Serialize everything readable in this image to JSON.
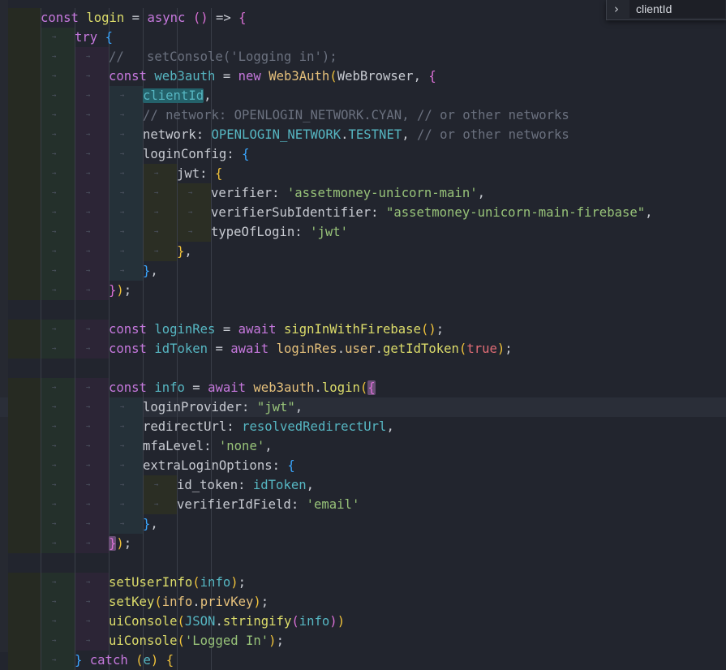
{
  "editor": {
    "current_line": 20,
    "lines": [
      {
        "indent": 0,
        "tokens": [
          [
            "k",
            "const "
          ],
          [
            "fn",
            "login"
          ],
          [
            "op",
            " = "
          ],
          [
            "k",
            "async"
          ],
          [
            "p",
            " "
          ],
          [
            "b2",
            "()"
          ],
          [
            "op",
            " => "
          ],
          [
            "b2",
            "{"
          ]
        ]
      },
      {
        "indent": 1,
        "tokens": [
          [
            "k",
            "try"
          ],
          [
            "p",
            " "
          ],
          [
            "b3",
            "{"
          ]
        ]
      },
      {
        "indent": 2,
        "tokens": [
          [
            "c",
            "//   setConsole('Logging in');"
          ]
        ]
      },
      {
        "indent": 2,
        "tokens": [
          [
            "k",
            "const "
          ],
          [
            "v",
            "web3auth"
          ],
          [
            "op",
            " = "
          ],
          [
            "k",
            "new "
          ],
          [
            "f",
            "Web3Auth"
          ],
          [
            "b1",
            "("
          ],
          [
            "p",
            "WebBrowser, "
          ],
          [
            "b2",
            "{"
          ]
        ]
      },
      {
        "indent": 3,
        "tokens": [
          [
            "v hl",
            "clientId"
          ],
          [
            "p",
            ","
          ]
        ]
      },
      {
        "indent": 3,
        "tokens": [
          [
            "c",
            "// network: OPENLOGIN_NETWORK.CYAN, // or other networks"
          ]
        ]
      },
      {
        "indent": 3,
        "tokens": [
          [
            "p",
            "network: "
          ],
          [
            "v",
            "OPENLOGIN_NETWORK"
          ],
          [
            "p",
            "."
          ],
          [
            "v",
            "TESTNET"
          ],
          [
            "p",
            ", "
          ],
          [
            "c",
            "// or other networks"
          ]
        ]
      },
      {
        "indent": 3,
        "tokens": [
          [
            "p",
            "loginConfig: "
          ],
          [
            "b3",
            "{"
          ]
        ]
      },
      {
        "indent": 4,
        "tokens": [
          [
            "p",
            "jwt: "
          ],
          [
            "b1",
            "{"
          ]
        ]
      },
      {
        "indent": 5,
        "tokens": [
          [
            "p",
            "verifier: "
          ],
          [
            "s",
            "'assetmoney-unicorn-main'"
          ],
          [
            "p",
            ","
          ]
        ]
      },
      {
        "indent": 5,
        "tokens": [
          [
            "p",
            "verifierSubIdentifier: "
          ],
          [
            "s",
            "\"assetmoney-unicorn-main-firebase\""
          ],
          [
            "p",
            ","
          ]
        ]
      },
      {
        "indent": 5,
        "tokens": [
          [
            "p",
            "typeOfLogin: "
          ],
          [
            "s",
            "'jwt'"
          ]
        ]
      },
      {
        "indent": 4,
        "tokens": [
          [
            "b1",
            "}"
          ],
          [
            "p",
            ","
          ]
        ]
      },
      {
        "indent": 3,
        "tokens": [
          [
            "b3",
            "}"
          ],
          [
            "p",
            ","
          ]
        ]
      },
      {
        "indent": 2,
        "tokens": [
          [
            "b2",
            "}"
          ],
          [
            "b1",
            ")"
          ],
          [
            "p",
            ";"
          ]
        ]
      },
      {
        "indent": 0,
        "tokens": []
      },
      {
        "indent": 2,
        "tokens": [
          [
            "k",
            "const "
          ],
          [
            "v",
            "loginRes"
          ],
          [
            "op",
            " = "
          ],
          [
            "k",
            "await "
          ],
          [
            "fn",
            "signInWithFirebase"
          ],
          [
            "b1",
            "()"
          ],
          [
            "p",
            ";"
          ]
        ]
      },
      {
        "indent": 2,
        "tokens": [
          [
            "k",
            "const "
          ],
          [
            "v",
            "idToken"
          ],
          [
            "op",
            " = "
          ],
          [
            "k",
            "await "
          ],
          [
            "f",
            "loginRes"
          ],
          [
            "p",
            "."
          ],
          [
            "f",
            "user"
          ],
          [
            "p",
            "."
          ],
          [
            "fn",
            "getIdToken"
          ],
          [
            "b1",
            "("
          ],
          [
            "num",
            "true"
          ],
          [
            "b1",
            ")"
          ],
          [
            "p",
            ";"
          ]
        ]
      },
      {
        "indent": 0,
        "tokens": []
      },
      {
        "indent": 2,
        "tokens": [
          [
            "k",
            "const "
          ],
          [
            "v",
            "info"
          ],
          [
            "op",
            " = "
          ],
          [
            "k",
            "await "
          ],
          [
            "f",
            "web3auth"
          ],
          [
            "p",
            "."
          ],
          [
            "fn",
            "login"
          ],
          [
            "b1",
            "("
          ],
          [
            "b2 mbr",
            "{"
          ]
        ]
      },
      {
        "indent": 3,
        "tokens": [
          [
            "p",
            "loginProvider: "
          ],
          [
            "s",
            "\"jwt\""
          ],
          [
            "p",
            ","
          ]
        ]
      },
      {
        "indent": 3,
        "tokens": [
          [
            "p",
            "redirectUrl: "
          ],
          [
            "v",
            "resolvedRedirectUrl"
          ],
          [
            "p",
            ","
          ]
        ]
      },
      {
        "indent": 3,
        "tokens": [
          [
            "p",
            "mfaLevel: "
          ],
          [
            "s",
            "'none'"
          ],
          [
            "p",
            ","
          ]
        ]
      },
      {
        "indent": 3,
        "tokens": [
          [
            "p",
            "extraLoginOptions: "
          ],
          [
            "b3",
            "{"
          ]
        ]
      },
      {
        "indent": 4,
        "tokens": [
          [
            "p",
            "id_token: "
          ],
          [
            "v",
            "idToken"
          ],
          [
            "p",
            ","
          ]
        ]
      },
      {
        "indent": 4,
        "tokens": [
          [
            "p",
            "verifierIdField: "
          ],
          [
            "s",
            "'email'"
          ]
        ]
      },
      {
        "indent": 3,
        "tokens": [
          [
            "b3",
            "}"
          ],
          [
            "p",
            ","
          ]
        ]
      },
      {
        "indent": 2,
        "tokens": [
          [
            "b2 mbr",
            "}"
          ],
          [
            "b1",
            ")"
          ],
          [
            "p",
            ";"
          ]
        ]
      },
      {
        "indent": 0,
        "tokens": []
      },
      {
        "indent": 2,
        "tokens": [
          [
            "fn",
            "setUserInfo"
          ],
          [
            "b1",
            "("
          ],
          [
            "v",
            "info"
          ],
          [
            "b1",
            ")"
          ],
          [
            "p",
            ";"
          ]
        ]
      },
      {
        "indent": 2,
        "tokens": [
          [
            "fn",
            "setKey"
          ],
          [
            "b1",
            "("
          ],
          [
            "f",
            "info"
          ],
          [
            "p",
            "."
          ],
          [
            "f",
            "privKey"
          ],
          [
            "b1",
            ")"
          ],
          [
            "p",
            ";"
          ]
        ]
      },
      {
        "indent": 2,
        "tokens": [
          [
            "fn",
            "uiConsole"
          ],
          [
            "b1",
            "("
          ],
          [
            "v",
            "JSON"
          ],
          [
            "p",
            "."
          ],
          [
            "fn",
            "stringify"
          ],
          [
            "b2",
            "("
          ],
          [
            "v",
            "info"
          ],
          [
            "b2",
            ")"
          ],
          [
            "b1",
            ")"
          ]
        ]
      },
      {
        "indent": 2,
        "tokens": [
          [
            "fn",
            "uiConsole"
          ],
          [
            "b1",
            "("
          ],
          [
            "s",
            "'Logged In'"
          ],
          [
            "b1",
            ")"
          ],
          [
            "p",
            ";"
          ]
        ]
      },
      {
        "indent": 1,
        "tokens": [
          [
            "b3",
            "}"
          ],
          [
            "p",
            " "
          ],
          [
            "k",
            "catch"
          ],
          [
            "p",
            " "
          ],
          [
            "b1",
            "("
          ],
          [
            "v",
            "e"
          ],
          [
            "b1",
            ")"
          ],
          [
            "p",
            " "
          ],
          [
            "b1",
            "{"
          ]
        ]
      }
    ]
  },
  "find_widget": {
    "toggle_icon": "chevron-right-icon",
    "toggle_glyph": "›",
    "query": "clientId"
  }
}
